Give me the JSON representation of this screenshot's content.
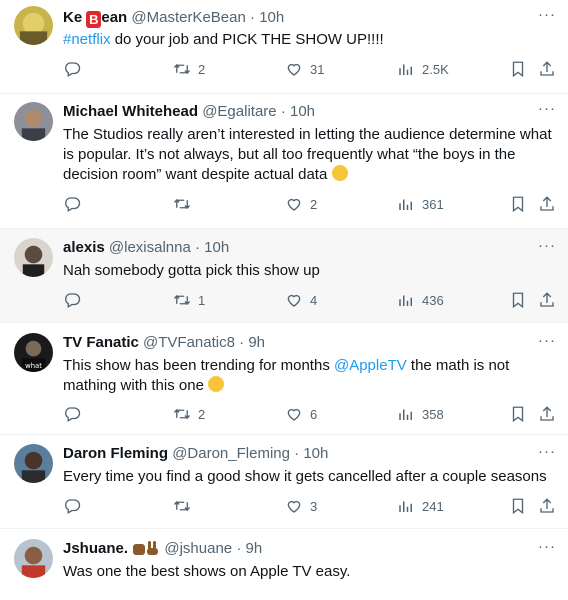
{
  "tweets": [
    {
      "name_a": "Ke",
      "name_badge": "B",
      "name_b": "ean",
      "handle": "@MasterKeBean",
      "time": "10h",
      "text_link": "#netflix",
      "text_rest": " do your job and PICK THE SHOW UP!!!!",
      "retweets": "2",
      "likes": "31",
      "views": "2.5K",
      "replies": ""
    },
    {
      "name": "Michael Whitehead",
      "handle": "@Egalitare",
      "time": "10h",
      "text": "The Studios really aren’t interested in letting the audience determine what is popular. It’s not always, but all too frequently what “the boys in the decision room” want despite actual data",
      "retweets": "",
      "likes": "2",
      "views": "361",
      "replies": ""
    },
    {
      "name": "alexis",
      "handle": "@lexisalnna",
      "time": "10h",
      "text": "Nah somebody gotta pick this show up",
      "retweets": "1",
      "likes": "4",
      "views": "436",
      "replies": ""
    },
    {
      "name": "TV Fanatic",
      "handle": "@TVFanatic8",
      "time": "9h",
      "text_a": "This show has been trending for months ",
      "text_link": "@AppleTV",
      "text_b": " the math is not mathing with this one",
      "retweets": "2",
      "likes": "6",
      "views": "358",
      "replies": ""
    },
    {
      "name": "Daron Fleming",
      "handle": "@Daron_Fleming",
      "time": "10h",
      "text": "Every time you find a good show it gets cancelled after a couple seasons",
      "retweets": "",
      "likes": "3",
      "views": "241",
      "replies": ""
    },
    {
      "name": "Jshuane.",
      "handle": "@jshuane",
      "time": "9h",
      "text": "Was one the best shows on Apple TV easy."
    }
  ],
  "ui": {
    "sep": "·",
    "more": "···"
  },
  "colors": {
    "link": "#1d9bf0",
    "muted": "#536471",
    "highlight_row": "#f7f7f7"
  }
}
